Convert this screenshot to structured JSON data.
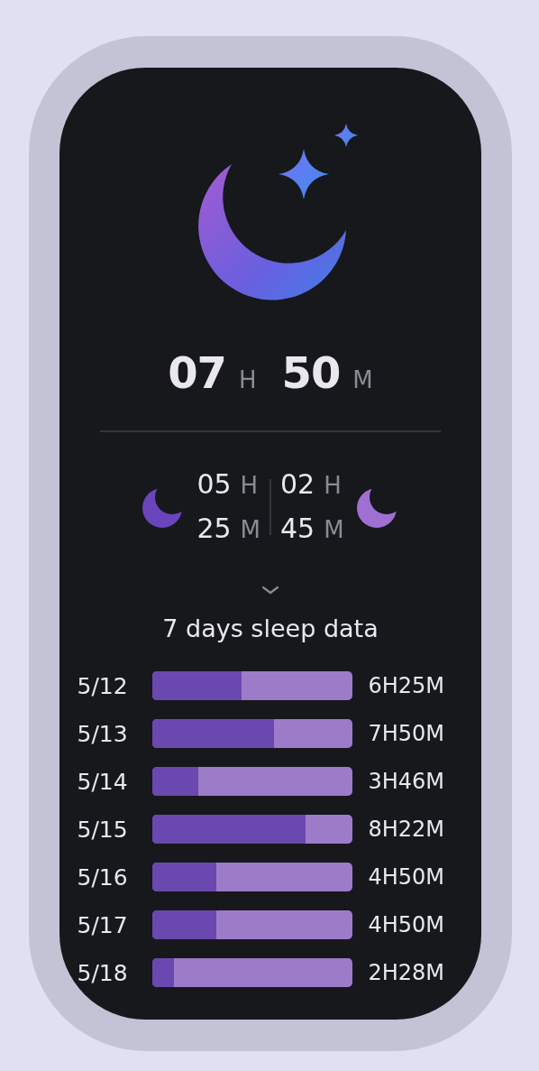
{
  "total": {
    "hours": "07",
    "hours_unit": "H",
    "minutes": "50",
    "minutes_unit": "M"
  },
  "stages": [
    {
      "hours": "05",
      "hours_unit": "H",
      "minutes": "25",
      "minutes_unit": "M",
      "color": "#6a44bd"
    },
    {
      "hours": "02",
      "hours_unit": "H",
      "minutes": "45",
      "minutes_unit": "M",
      "color": "#a06fd2"
    }
  ],
  "history_title": "7 days sleep data",
  "days": [
    {
      "date": "5/12",
      "level": 0.45,
      "duration": "6H25M"
    },
    {
      "date": "5/13",
      "level": 0.61,
      "duration": "7H50M"
    },
    {
      "date": "5/14",
      "level": 0.23,
      "duration": "3H46M"
    },
    {
      "date": "5/15",
      "level": 0.77,
      "duration": "8H22M"
    },
    {
      "date": "5/16",
      "level": 0.32,
      "duration": "4H50M"
    },
    {
      "date": "5/17",
      "level": 0.32,
      "duration": "4H50M"
    },
    {
      "date": "5/18",
      "level": 0.11,
      "duration": "2H28M"
    }
  ]
}
